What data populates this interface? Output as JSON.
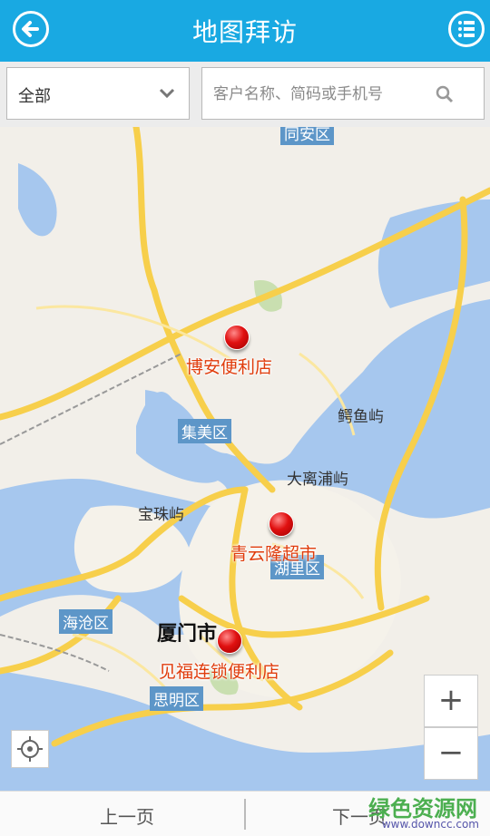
{
  "header": {
    "title": "地图拜访",
    "back_icon": "back-arrow-icon",
    "menu_icon": "list-menu-icon"
  },
  "filter": {
    "selected": "全部",
    "search_placeholder": "客户名称、简码或手机号"
  },
  "map": {
    "labels": {
      "tongan": "同安区",
      "jimei": "集美区",
      "haicang": "海沧区",
      "siming": "思明区",
      "huli": "湖里区",
      "xiamen": "厦门市",
      "baozhu": "宝珠屿",
      "eyu": "鳄鱼屿",
      "dali": "大离浦屿"
    },
    "stores": [
      {
        "name": "博安便利店"
      },
      {
        "name": "青云隆超市"
      },
      {
        "name": "见福连锁便利店"
      }
    ],
    "zoom_in": "+",
    "zoom_out": "−"
  },
  "footer": {
    "prev": "上一页",
    "next": "下一页"
  },
  "watermark": {
    "brand": "绿色资源网",
    "site": "www.downcc.com"
  },
  "colors": {
    "header": "#19a9e2",
    "water": "#a6c7ee",
    "road": "#f7cf4b",
    "pin": "#e01010",
    "store_label": "#e03c0c"
  }
}
